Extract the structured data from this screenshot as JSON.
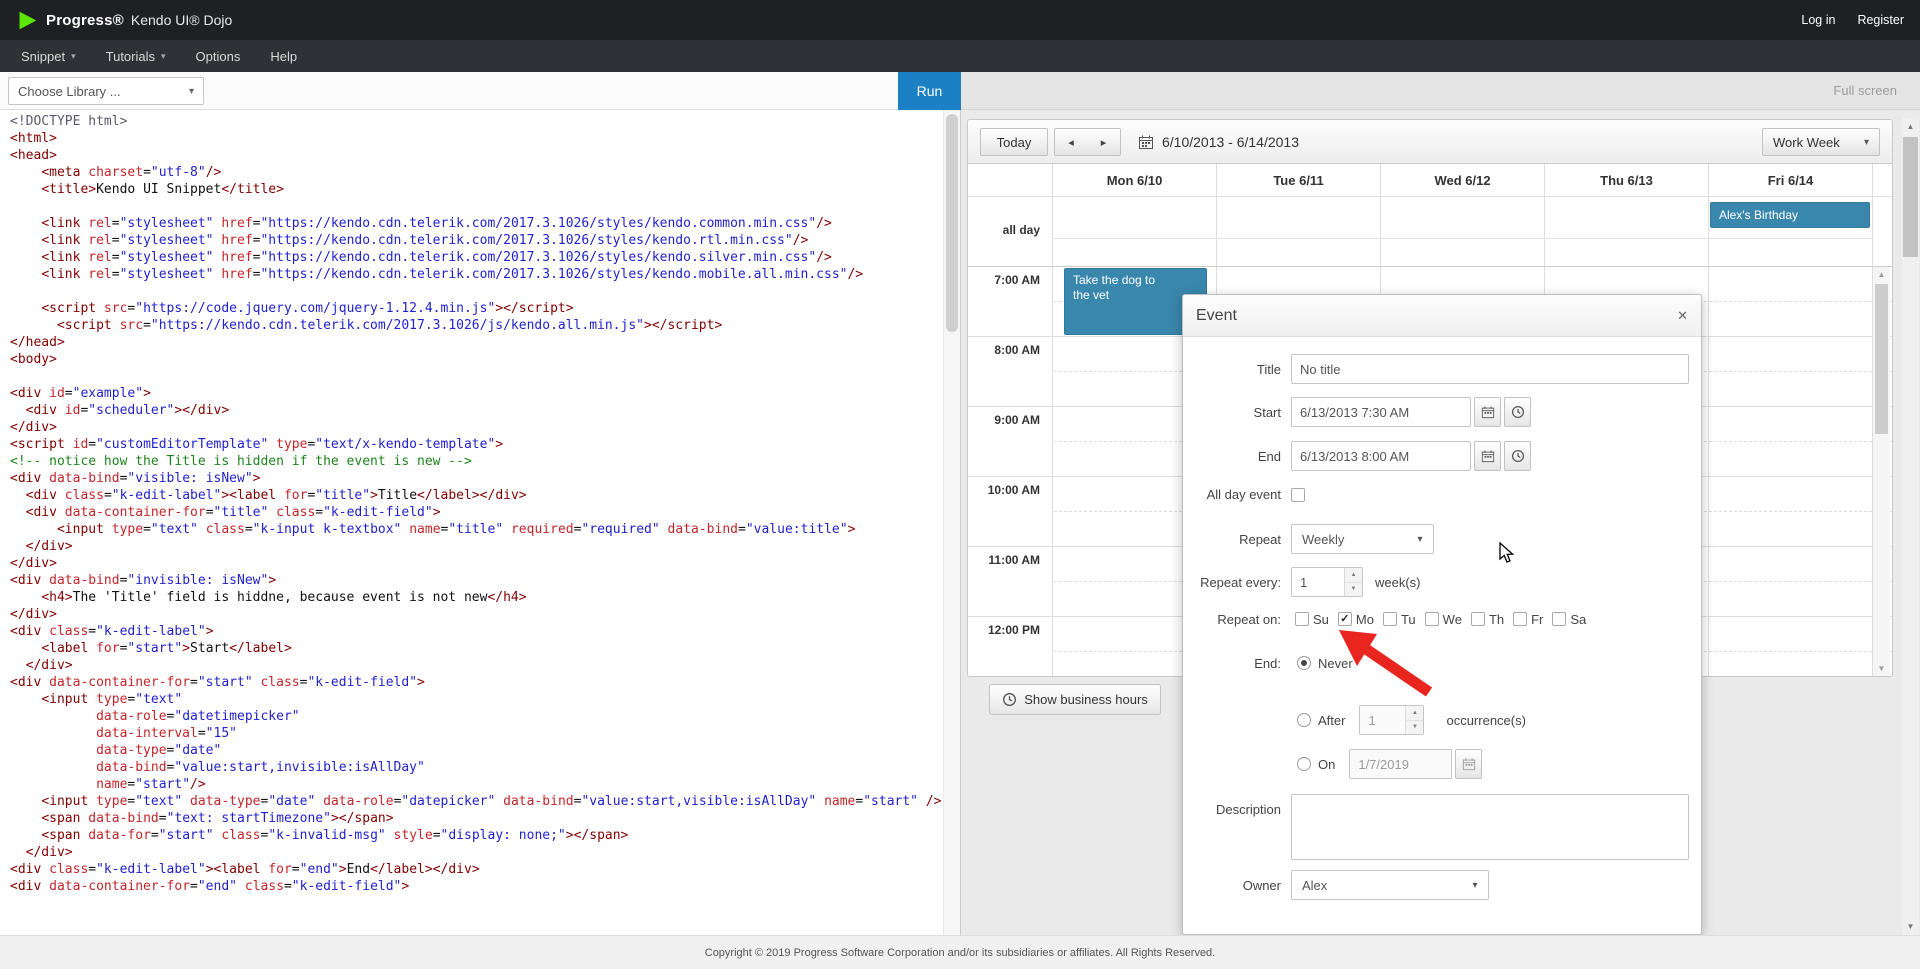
{
  "topbar": {
    "brand_progress": "Progress®",
    "brand_product": "Kendo UI® Dojo",
    "login": "Log in",
    "register": "Register"
  },
  "menubar": {
    "items": [
      {
        "label": "Snippet",
        "has_caret": true
      },
      {
        "label": "Tutorials",
        "has_caret": true
      },
      {
        "label": "Options",
        "has_caret": false
      },
      {
        "label": "Help",
        "has_caret": false
      }
    ]
  },
  "toolbar": {
    "choose_library": "Choose Library ...",
    "run": "Run",
    "full_screen": "Full screen"
  },
  "editor": {
    "lines": [
      [
        [
          "dt",
          "<!DOCTYPE html>"
        ]
      ],
      [
        [
          "tg",
          "<html>"
        ]
      ],
      [
        [
          "tg",
          "<head>"
        ]
      ],
      [
        [
          "pl",
          "    "
        ],
        [
          "tg",
          "<meta"
        ],
        [
          "at",
          " charset"
        ],
        [
          "pl",
          "="
        ],
        [
          "str",
          "\"utf-8\""
        ],
        [
          "tg",
          "/>"
        ]
      ],
      [
        [
          "pl",
          "    "
        ],
        [
          "tg",
          "<title>"
        ],
        [
          "pl",
          "Kendo UI Snippet"
        ],
        [
          "tg",
          "</title>"
        ]
      ],
      [],
      [
        [
          "pl",
          "    "
        ],
        [
          "tg",
          "<link"
        ],
        [
          "at",
          " rel"
        ],
        [
          "pl",
          "="
        ],
        [
          "str",
          "\"stylesheet\""
        ],
        [
          "at",
          " href"
        ],
        [
          "pl",
          "="
        ],
        [
          "str",
          "\"https://kendo.cdn.telerik.com/2017.3.1026/styles/kendo.common.min.css\""
        ],
        [
          "tg",
          "/>"
        ]
      ],
      [
        [
          "pl",
          "    "
        ],
        [
          "tg",
          "<link"
        ],
        [
          "at",
          " rel"
        ],
        [
          "pl",
          "="
        ],
        [
          "str",
          "\"stylesheet\""
        ],
        [
          "at",
          " href"
        ],
        [
          "pl",
          "="
        ],
        [
          "str",
          "\"https://kendo.cdn.telerik.com/2017.3.1026/styles/kendo.rtl.min.css\""
        ],
        [
          "tg",
          "/>"
        ]
      ],
      [
        [
          "pl",
          "    "
        ],
        [
          "tg",
          "<link"
        ],
        [
          "at",
          " rel"
        ],
        [
          "pl",
          "="
        ],
        [
          "str",
          "\"stylesheet\""
        ],
        [
          "at",
          " href"
        ],
        [
          "pl",
          "="
        ],
        [
          "str",
          "\"https://kendo.cdn.telerik.com/2017.3.1026/styles/kendo.silver.min.css\""
        ],
        [
          "tg",
          "/>"
        ]
      ],
      [
        [
          "pl",
          "    "
        ],
        [
          "tg",
          "<link"
        ],
        [
          "at",
          " rel"
        ],
        [
          "pl",
          "="
        ],
        [
          "str",
          "\"stylesheet\""
        ],
        [
          "at",
          " href"
        ],
        [
          "pl",
          "="
        ],
        [
          "str",
          "\"https://kendo.cdn.telerik.com/2017.3.1026/styles/kendo.mobile.all.min.css\""
        ],
        [
          "tg",
          "/>"
        ]
      ],
      [],
      [
        [
          "pl",
          "    "
        ],
        [
          "tg",
          "<script"
        ],
        [
          "at",
          " src"
        ],
        [
          "pl",
          "="
        ],
        [
          "str",
          "\"https://code.jquery.com/jquery-1.12.4.min.js\""
        ],
        [
          "tg",
          "></script>"
        ]
      ],
      [
        [
          "pl",
          "      "
        ],
        [
          "tg",
          "<script"
        ],
        [
          "at",
          " src"
        ],
        [
          "pl",
          "="
        ],
        [
          "str",
          "\"https://kendo.cdn.telerik.com/2017.3.1026/js/kendo.all.min.js\""
        ],
        [
          "tg",
          "></script>"
        ]
      ],
      [
        [
          "tg",
          "</head>"
        ]
      ],
      [
        [
          "tg",
          "<body>"
        ]
      ],
      [],
      [
        [
          "tg",
          "<div"
        ],
        [
          "at",
          " id"
        ],
        [
          "pl",
          "="
        ],
        [
          "str",
          "\"example\""
        ],
        [
          "tg",
          ">"
        ]
      ],
      [
        [
          "pl",
          "  "
        ],
        [
          "tg",
          "<div"
        ],
        [
          "at",
          " id"
        ],
        [
          "pl",
          "="
        ],
        [
          "str",
          "\"scheduler\""
        ],
        [
          "tg",
          "></div>"
        ]
      ],
      [
        [
          "tg",
          "</div>"
        ]
      ],
      [
        [
          "tg",
          "<script"
        ],
        [
          "at",
          " id"
        ],
        [
          "pl",
          "="
        ],
        [
          "str",
          "\"customEditorTemplate\""
        ],
        [
          "at",
          " type"
        ],
        [
          "pl",
          "="
        ],
        [
          "str",
          "\"text/x-kendo-template\""
        ],
        [
          "tg",
          ">"
        ]
      ],
      [
        [
          "cm",
          "<!-- notice how the Title is hidden if the event is new -->"
        ]
      ],
      [
        [
          "tg",
          "<div"
        ],
        [
          "at",
          " data-bind"
        ],
        [
          "pl",
          "="
        ],
        [
          "str",
          "\"visible: isNew\""
        ],
        [
          "tg",
          ">"
        ]
      ],
      [
        [
          "pl",
          "  "
        ],
        [
          "tg",
          "<div"
        ],
        [
          "at",
          " class"
        ],
        [
          "pl",
          "="
        ],
        [
          "str",
          "\"k-edit-label\""
        ],
        [
          "tg",
          "><label"
        ],
        [
          "at",
          " for"
        ],
        [
          "pl",
          "="
        ],
        [
          "str",
          "\"title\""
        ],
        [
          "tg",
          ">"
        ],
        [
          "pl",
          "Title"
        ],
        [
          "tg",
          "</label></div>"
        ]
      ],
      [
        [
          "pl",
          "  "
        ],
        [
          "tg",
          "<div"
        ],
        [
          "at",
          " data-container-for"
        ],
        [
          "pl",
          "="
        ],
        [
          "str",
          "\"title\""
        ],
        [
          "at",
          " class"
        ],
        [
          "pl",
          "="
        ],
        [
          "str",
          "\"k-edit-field\""
        ],
        [
          "tg",
          ">"
        ]
      ],
      [
        [
          "pl",
          "      "
        ],
        [
          "tg",
          "<input"
        ],
        [
          "at",
          " type"
        ],
        [
          "pl",
          "="
        ],
        [
          "str",
          "\"text\""
        ],
        [
          "at",
          " class"
        ],
        [
          "pl",
          "="
        ],
        [
          "str",
          "\"k-input k-textbox\""
        ],
        [
          "at",
          " name"
        ],
        [
          "pl",
          "="
        ],
        [
          "str",
          "\"title\""
        ],
        [
          "at",
          " required"
        ],
        [
          "pl",
          "="
        ],
        [
          "str",
          "\"required\""
        ],
        [
          "at",
          " data-bind"
        ],
        [
          "pl",
          "="
        ],
        [
          "str",
          "\"value:title\""
        ],
        [
          "tg",
          ">"
        ]
      ],
      [
        [
          "pl",
          "  "
        ],
        [
          "tg",
          "</div>"
        ]
      ],
      [
        [
          "tg",
          "</div>"
        ]
      ],
      [
        [
          "tg",
          "<div"
        ],
        [
          "at",
          " data-bind"
        ],
        [
          "pl",
          "="
        ],
        [
          "str",
          "\"invisible: isNew\""
        ],
        [
          "tg",
          ">"
        ]
      ],
      [
        [
          "pl",
          "    "
        ],
        [
          "tg",
          "<h4>"
        ],
        [
          "pl",
          "The 'Title' field is hiddne, because event is not new"
        ],
        [
          "tg",
          "</h4>"
        ]
      ],
      [
        [
          "tg",
          "</div>"
        ]
      ],
      [
        [
          "tg",
          "<div"
        ],
        [
          "at",
          " class"
        ],
        [
          "pl",
          "="
        ],
        [
          "str",
          "\"k-edit-label\""
        ],
        [
          "tg",
          ">"
        ]
      ],
      [
        [
          "pl",
          "    "
        ],
        [
          "tg",
          "<label"
        ],
        [
          "at",
          " for"
        ],
        [
          "pl",
          "="
        ],
        [
          "str",
          "\"start\""
        ],
        [
          "tg",
          ">"
        ],
        [
          "pl",
          "Start"
        ],
        [
          "tg",
          "</label>"
        ]
      ],
      [
        [
          "pl",
          "  "
        ],
        [
          "tg",
          "</div>"
        ]
      ],
      [
        [
          "tg",
          "<div"
        ],
        [
          "at",
          " data-container-for"
        ],
        [
          "pl",
          "="
        ],
        [
          "str",
          "\"start\""
        ],
        [
          "at",
          " class"
        ],
        [
          "pl",
          "="
        ],
        [
          "str",
          "\"k-edit-field\""
        ],
        [
          "tg",
          ">"
        ]
      ],
      [
        [
          "pl",
          "    "
        ],
        [
          "tg",
          "<input"
        ],
        [
          "at",
          " type"
        ],
        [
          "pl",
          "="
        ],
        [
          "str",
          "\"text\""
        ]
      ],
      [
        [
          "at",
          "           data-role"
        ],
        [
          "pl",
          "="
        ],
        [
          "str",
          "\"datetimepicker\""
        ]
      ],
      [
        [
          "at",
          "           data-interval"
        ],
        [
          "pl",
          "="
        ],
        [
          "str",
          "\"15\""
        ]
      ],
      [
        [
          "at",
          "           data-type"
        ],
        [
          "pl",
          "="
        ],
        [
          "str",
          "\"date\""
        ]
      ],
      [
        [
          "at",
          "           data-bind"
        ],
        [
          "pl",
          "="
        ],
        [
          "str",
          "\"value:start,invisible:isAllDay\""
        ]
      ],
      [
        [
          "at",
          "           name"
        ],
        [
          "pl",
          "="
        ],
        [
          "str",
          "\"start\""
        ],
        [
          "tg",
          "/>"
        ]
      ],
      [
        [
          "pl",
          "    "
        ],
        [
          "tg",
          "<input"
        ],
        [
          "at",
          " type"
        ],
        [
          "pl",
          "="
        ],
        [
          "str",
          "\"text\""
        ],
        [
          "at",
          " data-type"
        ],
        [
          "pl",
          "="
        ],
        [
          "str",
          "\"date\""
        ],
        [
          "at",
          " data-role"
        ],
        [
          "pl",
          "="
        ],
        [
          "str",
          "\"datepicker\""
        ],
        [
          "at",
          " data-bind"
        ],
        [
          "pl",
          "="
        ],
        [
          "str",
          "\"value:start,visible:isAllDay\""
        ],
        [
          "at",
          " name"
        ],
        [
          "pl",
          "="
        ],
        [
          "str",
          "\"start\""
        ],
        [
          "tg",
          " />"
        ]
      ],
      [
        [
          "pl",
          "    "
        ],
        [
          "tg",
          "<span"
        ],
        [
          "at",
          " data-bind"
        ],
        [
          "pl",
          "="
        ],
        [
          "str",
          "\"text: startTimezone\""
        ],
        [
          "tg",
          "></span>"
        ]
      ],
      [
        [
          "pl",
          "    "
        ],
        [
          "tg",
          "<span"
        ],
        [
          "at",
          " data-for"
        ],
        [
          "pl",
          "="
        ],
        [
          "str",
          "\"start\""
        ],
        [
          "at",
          " class"
        ],
        [
          "pl",
          "="
        ],
        [
          "str",
          "\"k-invalid-msg\""
        ],
        [
          "at",
          " style"
        ],
        [
          "pl",
          "="
        ],
        [
          "str",
          "\"display: none;\""
        ],
        [
          "tg",
          "></span>"
        ]
      ],
      [
        [
          "pl",
          "  "
        ],
        [
          "tg",
          "</div>"
        ]
      ],
      [
        [
          "tg",
          "<div"
        ],
        [
          "at",
          " class"
        ],
        [
          "pl",
          "="
        ],
        [
          "str",
          "\"k-edit-label\""
        ],
        [
          "tg",
          "><label"
        ],
        [
          "at",
          " for"
        ],
        [
          "pl",
          "="
        ],
        [
          "str",
          "\"end\""
        ],
        [
          "tg",
          ">"
        ],
        [
          "pl",
          "End"
        ],
        [
          "tg",
          "</label></div>"
        ]
      ],
      [
        [
          "tg",
          "<div"
        ],
        [
          "at",
          " data-container-for"
        ],
        [
          "pl",
          "="
        ],
        [
          "str",
          "\"end\""
        ],
        [
          "at",
          " class"
        ],
        [
          "pl",
          "="
        ],
        [
          "str",
          "\"k-edit-field\""
        ],
        [
          "tg",
          ">"
        ]
      ]
    ]
  },
  "scheduler": {
    "toolbar": {
      "today": "Today",
      "date_range": "6/10/2013 - 6/14/2013",
      "view": "Work Week"
    },
    "all_day_label": "all day",
    "days": [
      "Mon 6/10",
      "Tue 6/11",
      "Wed 6/12",
      "Thu 6/13",
      "Fri 6/14"
    ],
    "times": [
      "7:00 AM",
      "8:00 AM",
      "9:00 AM",
      "10:00 AM",
      "11:00 AM",
      "12:00 PM"
    ],
    "events": {
      "allday": {
        "title": "Alex's Birthday",
        "day": "Fri 6/14"
      },
      "timed": {
        "title": "Take the dog to the vet",
        "day": "Mon 6/10",
        "start": "7:00 AM",
        "end": "8:00 AM"
      }
    },
    "show_business_hours": "Show business hours"
  },
  "dialog": {
    "title": "Event",
    "fields": {
      "title_label": "Title",
      "title_value": "No title",
      "start_label": "Start",
      "start_value": "6/13/2013 7:30 AM",
      "end_label": "End",
      "end_value": "6/13/2013 8:00 AM",
      "all_day_label": "All day event",
      "repeat_label": "Repeat",
      "repeat_value": "Weekly",
      "repeat_every_label": "Repeat every:",
      "repeat_every_value": "1",
      "repeat_every_unit": "week(s)",
      "repeat_on_label": "Repeat on:",
      "repeat_days": [
        {
          "label": "Su",
          "checked": false
        },
        {
          "label": "Mo",
          "checked": true
        },
        {
          "label": "Tu",
          "checked": false
        },
        {
          "label": "We",
          "checked": false
        },
        {
          "label": "Th",
          "checked": false
        },
        {
          "label": "Fr",
          "checked": false
        },
        {
          "label": "Sa",
          "checked": false
        }
      ],
      "end_section_label": "End:",
      "end_never": "Never",
      "end_after": "After",
      "after_value": "1",
      "after_unit": "occurrence(s)",
      "end_on": "On",
      "on_value": "1/7/2019",
      "description_label": "Description",
      "owner_label": "Owner",
      "owner_value": "Alex"
    }
  },
  "footer": {
    "copyright": "Copyright © 2019 Progress Software Corporation and/or its subsidiaries or affiliates. All Rights Reserved."
  },
  "colors": {
    "brand_green": "#5ce500",
    "run_blue": "#1b80c4",
    "event_blue": "#3a87ad",
    "arrow_red": "#e8251f"
  }
}
